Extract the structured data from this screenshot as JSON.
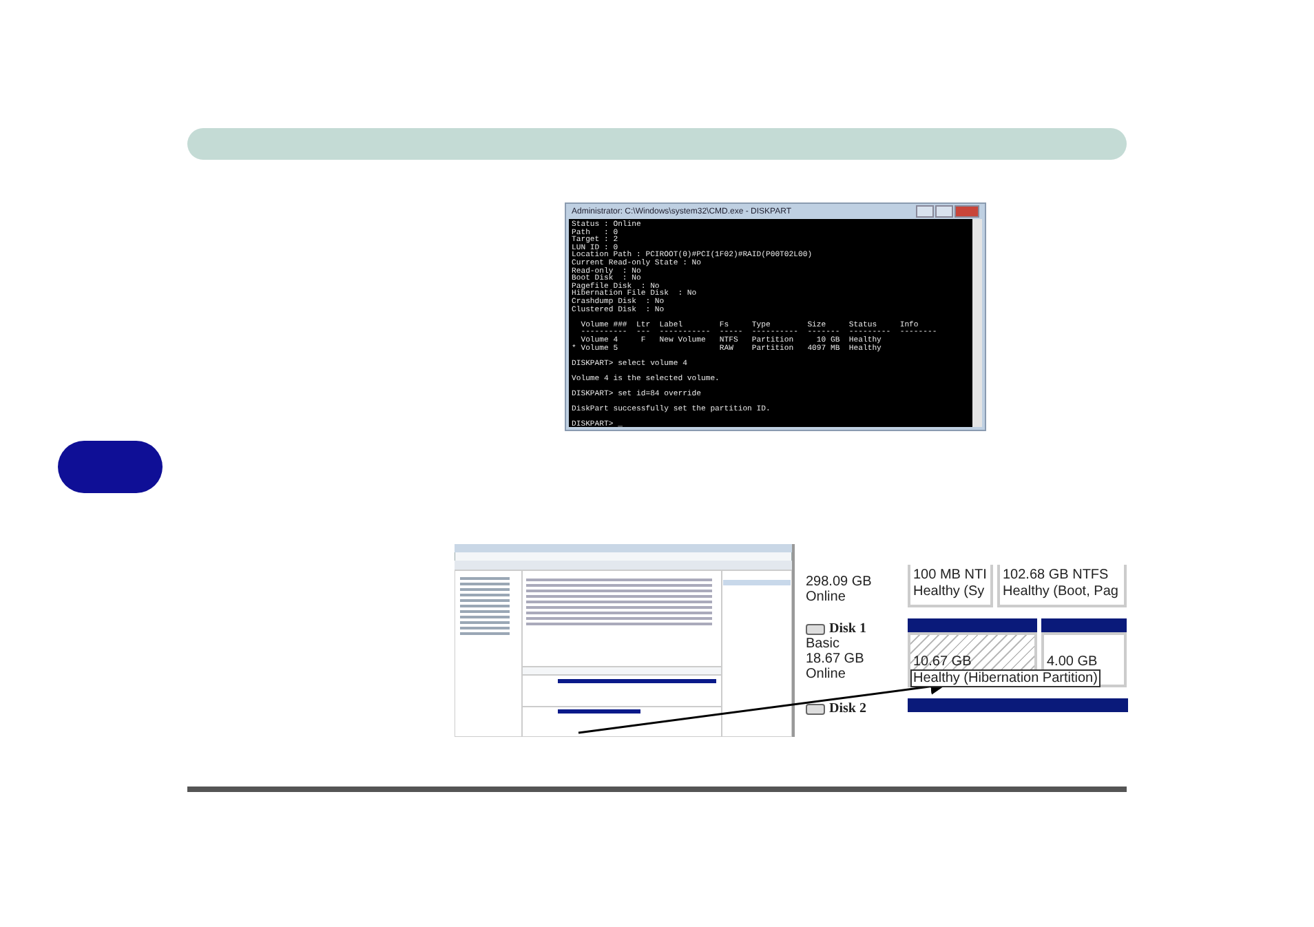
{
  "console": {
    "title": "Administrator: C:\\Windows\\system32\\CMD.exe - DISKPART",
    "blocks": [
      [
        "Status : Online",
        "Path   : 0",
        "Target : 2",
        "LUN ID : 0",
        "Location Path : PCIROOT(0)#PCI(1F02)#RAID(P00T02L00)",
        "Current Read-only State : No",
        "Read-only  : No",
        "Boot Disk  : No",
        "Pagefile Disk  : No",
        "Hibernation File Disk  : No",
        "Crashdump Disk  : No",
        "Clustered Disk  : No"
      ],
      [
        "  Volume ###  Ltr  Label        Fs     Type        Size     Status     Info",
        "  ----------  ---  -----------  -----  ----------  -------  ---------  --------",
        "  Volume 4     F   New Volume   NTFS   Partition     10 GB  Healthy",
        "* Volume 5                      RAW    Partition   4097 MB  Healthy"
      ],
      [
        "DISKPART> select volume 4"
      ],
      [
        "Volume 4 is the selected volume."
      ],
      [
        "DISKPART> set id=84 override"
      ],
      [
        "DiskPart successfully set the partition ID."
      ],
      [
        "DISKPART> _"
      ]
    ]
  },
  "disk_view": {
    "disks": [
      {
        "size": "298.09 GB",
        "status": "Online",
        "partitions": [
          {
            "size": "100 MB NTI",
            "status": "Healthy (Sy",
            "hatched": false,
            "boxed": false
          },
          {
            "size": "102.68 GB NTFS",
            "status": "Healthy (Boot, Pag",
            "hatched": false,
            "boxed": false
          }
        ]
      },
      {
        "name": "Disk 1",
        "type": "Basic",
        "size": "18.67 GB",
        "status": "Online",
        "partitions": [
          {
            "size": "10.67 GB",
            "status": "Healthy (Hibernation Partition)",
            "hatched": true,
            "boxed": true
          },
          {
            "size": "4.00 GB",
            "hatched": false
          }
        ]
      },
      {
        "name": "Disk 2"
      }
    ]
  }
}
